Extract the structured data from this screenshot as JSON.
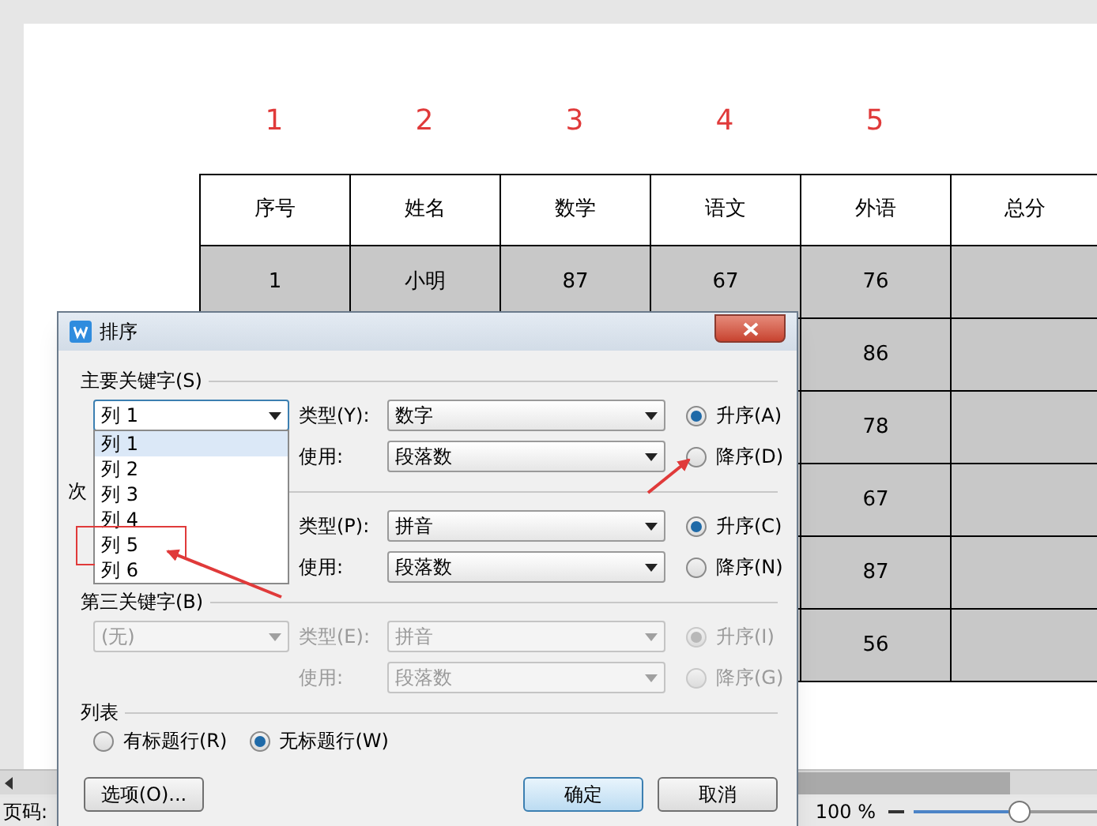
{
  "page": {
    "column_numbers": [
      "1",
      "2",
      "3",
      "4",
      "5"
    ],
    "table": {
      "columns": [
        "序号",
        "姓名",
        "数学",
        "语文",
        "外语",
        "总分"
      ],
      "rows": [
        {
          "cells": [
            "1",
            "小明",
            "87",
            "67",
            "76"
          ]
        },
        {
          "cells": [
            "86"
          ]
        },
        {
          "cells": [
            "78"
          ]
        },
        {
          "cells": [
            "67"
          ]
        },
        {
          "cells": [
            "87"
          ]
        },
        {
          "cells": [
            "56"
          ]
        }
      ]
    }
  },
  "dialog": {
    "title": "排序",
    "keys": [
      {
        "label": "主要关键字(S)",
        "column": "列 1",
        "type_label": "类型(Y):",
        "type": "数字",
        "use_label": "使用:",
        "use": "段落数",
        "disabled": false,
        "options": [
          {
            "label": "升序(A)",
            "selected": true
          },
          {
            "label": "降序(D)",
            "selected": false
          }
        ]
      },
      {
        "label": "次",
        "type_label": "类型(P):",
        "type": "拼音",
        "use_label": "使用:",
        "use": "段落数",
        "disabled": false,
        "options": [
          {
            "label": "升序(C)",
            "selected": true
          },
          {
            "label": "降序(N)",
            "selected": false
          }
        ]
      },
      {
        "label": "第三关键字(B)",
        "column": "(无)",
        "type_label": "类型(E):",
        "type": "拼音",
        "use_label": "使用:",
        "use": "段落数",
        "disabled": true,
        "options": [
          {
            "label": "升序(I)",
            "selected": true
          },
          {
            "label": "降序(G)",
            "selected": false
          }
        ]
      }
    ],
    "dropdown": {
      "items": [
        {
          "label": "列 1",
          "selected": true,
          "circled": false
        },
        {
          "label": "列 2",
          "selected": false,
          "circled": false
        },
        {
          "label": "列 3",
          "selected": false,
          "circled": false
        },
        {
          "label": "列 4",
          "selected": false,
          "circled": false
        },
        {
          "label": "列 5",
          "selected": false,
          "circled": true
        },
        {
          "label": "列 6",
          "selected": false,
          "circled": false
        }
      ]
    },
    "list_section": {
      "label": "列表",
      "options": [
        {
          "label": "有标题行(R)",
          "selected": false
        },
        {
          "label": "无标题行(W)",
          "selected": true
        }
      ]
    },
    "buttons": [
      {
        "label": "选项(O)...",
        "kind": "secondary"
      },
      {
        "label": "确定",
        "kind": "default"
      },
      {
        "label": "取消",
        "kind": "secondary"
      }
    ]
  },
  "status_bar": {
    "page_label": "页码:",
    "zoom_text": "100 %",
    "zoom": {
      "level": 0.58
    }
  }
}
